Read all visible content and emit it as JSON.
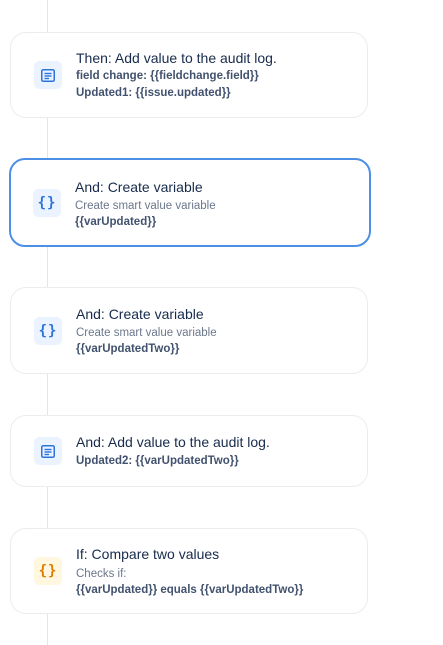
{
  "steps": [
    {
      "title": "Then: Add value to the audit log.",
      "icon": "audit-log-icon",
      "lines": [
        "field change: {{fieldchange.field}}",
        "Updated1: {{issue.updated}}"
      ]
    },
    {
      "title": "And: Create variable",
      "icon": "variable-braces-icon",
      "subtitle": "Create smart value variable",
      "lines": [
        "{{varUpdated}}"
      ]
    },
    {
      "title": "And: Create variable",
      "icon": "variable-braces-icon",
      "subtitle": "Create smart value variable",
      "lines": [
        "{{varUpdatedTwo}}"
      ]
    },
    {
      "title": "And: Add value to the audit log.",
      "icon": "audit-log-icon",
      "lines": [
        "Updated2: {{varUpdatedTwo}}"
      ]
    },
    {
      "title": "If: Compare two values",
      "icon": "condition-braces-icon",
      "subtitle": "Checks if:",
      "lines": [
        "{{varUpdated}} equals {{varUpdatedTwo}}"
      ]
    }
  ],
  "icon_glyphs": {
    "braces": "{}"
  },
  "colors": {
    "selected_border": "#4c8fe5",
    "action_icon": "#2d73d9",
    "condition_icon": "#e07b00"
  }
}
